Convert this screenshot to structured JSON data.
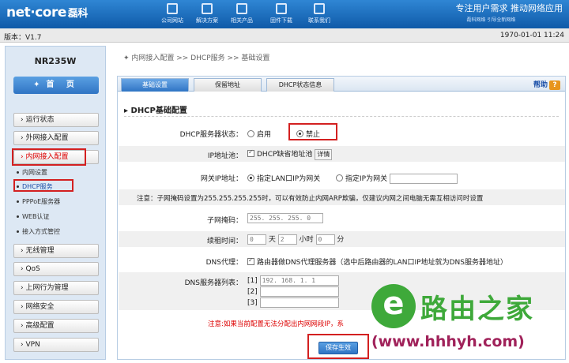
{
  "header": {
    "logo_text": "net·core",
    "logo_cn": "磊科",
    "nav": [
      {
        "label": "公司网站",
        "icon": "monitor-icon"
      },
      {
        "label": "解决方案",
        "icon": "tools-icon"
      },
      {
        "label": "相关产品",
        "icon": "grid-icon"
      },
      {
        "label": "固件下载",
        "icon": "download-icon"
      },
      {
        "label": "联系我们",
        "icon": "phone-icon"
      }
    ],
    "slogan": "专注用户需求   推动网络应用",
    "slogan_sub": "磊科网络 引导全新网络"
  },
  "infobar": {
    "version": "版本：V1.7",
    "datetime": "1970-01-01 11:24"
  },
  "sidebar": {
    "model": "NR235W",
    "home": "首 页",
    "menu": [
      {
        "label": "› 运行状态"
      },
      {
        "label": "› 外网接入配置"
      },
      {
        "label": "› 内网接入配置"
      },
      {
        "label": "› 无线管理"
      },
      {
        "label": "› QoS"
      },
      {
        "label": "› 上网行为管理"
      },
      {
        "label": "› 网络安全"
      },
      {
        "label": "› 高级配置"
      },
      {
        "label": "› VPN"
      }
    ],
    "submenu": [
      "内网设置",
      "DHCP服务",
      "PPPoE服务器",
      "WEB认证",
      "接入方式管控"
    ]
  },
  "breadcrumb": "内网接入配置  >>  DHCP服务  >>  基础设置",
  "tabs": [
    "基础设置",
    "保留地址",
    "DHCP状态信息"
  ],
  "help": "帮助",
  "section_title": "DHCP基础配置",
  "form": {
    "dhcp_status_label": "DHCP服务器状态：",
    "enable": "启用",
    "disable": "禁止",
    "ip_pool_label": "IP地址池：",
    "ip_pool_text": "DHCP缺省地址池",
    "details": "详情",
    "gateway_label": "网关IP地址：",
    "gw_opt1": "指定LAN口IP为网关",
    "gw_opt2": "指定IP为网关",
    "note": "注意：子网掩码设置为255.255.255.255时，可以有效防止内网ARP欺骗，仅建议内网之间电脑无需互相访问时设置",
    "mask_label": "子网掩码：",
    "mask_value": "255. 255. 255. 0",
    "lease_label": "续租时间：",
    "lease_days": "0",
    "lease_days_unit": "天",
    "lease_hours": "2",
    "lease_hours_unit": "小时",
    "lease_min": "0",
    "lease_min_unit": "分",
    "dns_proxy_label": "DNS代理：",
    "dns_proxy_text": "路由器做DNS代理服务器（选中后路由器的LAN口IP地址就为DNS服务器地址）",
    "dns_list_label": "DNS服务器列表：",
    "dns": [
      {
        "idx": "[1]",
        "val": "192. 168. 1. 1"
      },
      {
        "idx": "[2]",
        "val": ""
      },
      {
        "idx": "[3]",
        "val": ""
      }
    ],
    "warning": "注意:如果当前配置无法分配出内网网段IP，系",
    "save": "保存生效"
  },
  "watermark": {
    "e": "e",
    "text": "路由之家",
    "url": "(www.hhhyh.com)"
  },
  "colors": {
    "accent": "#2f74c4",
    "highlight": "#d32020",
    "watermark_green": "#3ea93a"
  }
}
